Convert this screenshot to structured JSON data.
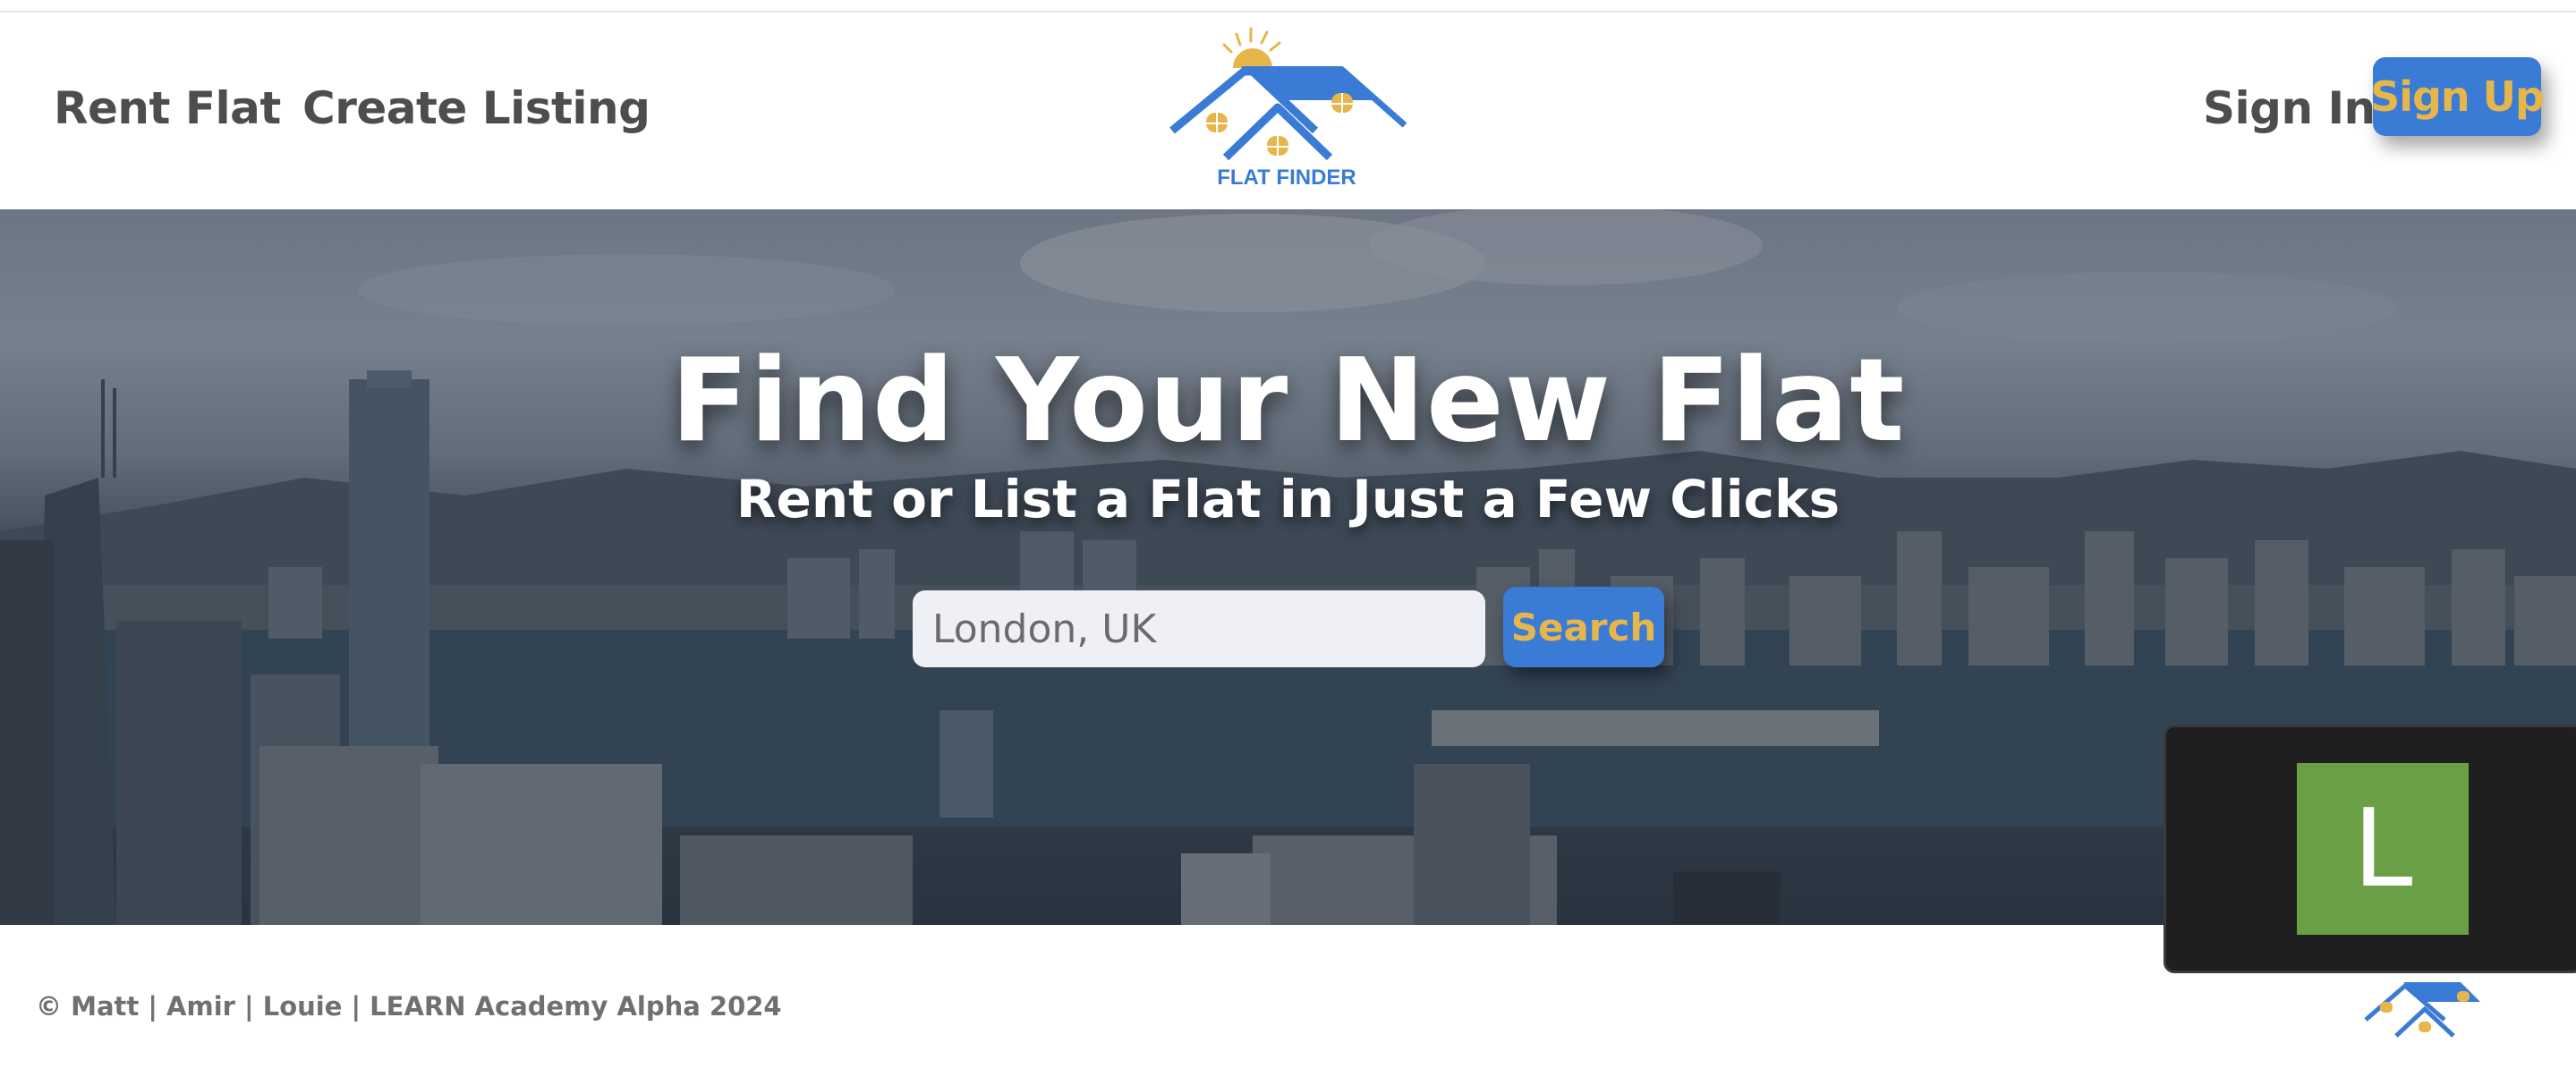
{
  "header": {
    "nav": {
      "rent_flat": "Rent Flat",
      "create_listing": "Create Listing"
    },
    "auth": {
      "sign_in": "Sign In",
      "sign_up": "Sign Up"
    },
    "logo_text": "FLAT FINDER"
  },
  "hero": {
    "title": "Find Your New Flat",
    "subtitle": "Rent or List a Flat in Just a Few Clicks",
    "search": {
      "placeholder": "London, UK",
      "button": "Search"
    }
  },
  "footer": {
    "credit": "© Matt | Amir | Louie | LEARN Academy Alpha 2024"
  },
  "avatar": {
    "initial": "L",
    "color": "#6a9f45"
  },
  "colors": {
    "brand_blue": "#3a7bd5",
    "accent_gold": "#e7b64a",
    "nav_text": "#4d4d4d"
  }
}
